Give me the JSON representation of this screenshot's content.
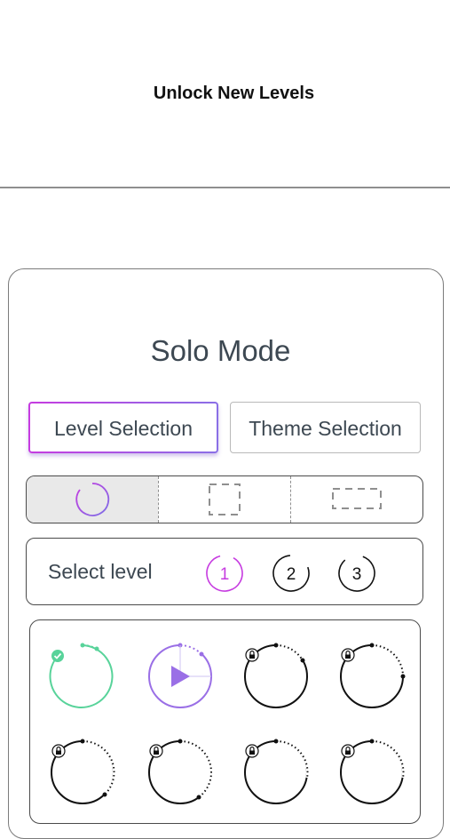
{
  "header": {
    "title": "Unlock New Levels"
  },
  "panel": {
    "title": "Solo Mode",
    "tabs": [
      {
        "label": "Level Selection",
        "active": true
      },
      {
        "label": "Theme Selection",
        "active": false
      }
    ],
    "shapes": [
      {
        "icon": "circle-shape-icon",
        "selected": true
      },
      {
        "icon": "square-shape-icon",
        "selected": false
      },
      {
        "icon": "rectangle-shape-icon",
        "selected": false
      }
    ],
    "level_select": {
      "label": "Select level",
      "options": [
        "1",
        "2",
        "3"
      ],
      "selected": "1"
    },
    "levels": [
      {
        "status": "completed",
        "icon": "check-icon"
      },
      {
        "status": "current",
        "icon": "play-icon"
      },
      {
        "status": "locked",
        "icon": "lock-icon"
      },
      {
        "status": "locked",
        "icon": "lock-icon"
      },
      {
        "status": "locked",
        "icon": "lock-icon"
      },
      {
        "status": "locked",
        "icon": "lock-icon"
      },
      {
        "status": "locked",
        "icon": "lock-icon"
      },
      {
        "status": "locked",
        "icon": "lock-icon"
      }
    ],
    "colors": {
      "accent": "#c63be0",
      "purple": "#9a6fe6",
      "completed": "#58d39a",
      "text": "#3d4852"
    }
  }
}
